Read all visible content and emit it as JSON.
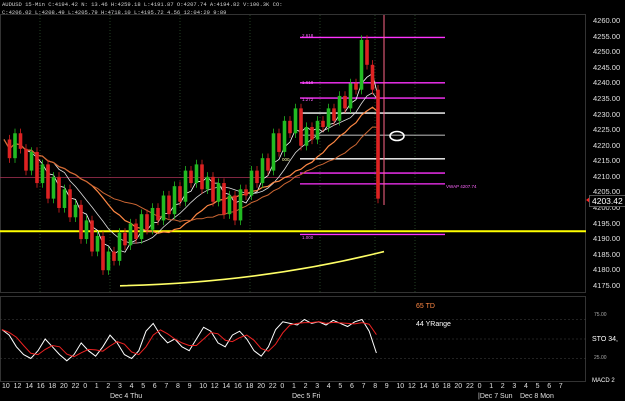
{
  "header": {
    "line1": "AUDUSD 15-Min  C:4194.42  N: 13.46  H:4259.18  L:4191.87  O:4207.74  A:4194.82  V:100.3K  CO:",
    "line2": "C:4206.02  L:4208.49  L:4205.79  H:4718.10  L:4195.72  4.56  12:04:29  9:89"
  },
  "price_axis": {
    "ticks": [
      "4260.00",
      "4255.00",
      "4250.00",
      "4245.00",
      "4240.00",
      "4235.00",
      "4230.00",
      "4225.00",
      "4220.00",
      "4215.00",
      "4210.00",
      "4205.00",
      "4200.00",
      "4195.00",
      "4190.00",
      "4185.00",
      "4180.00",
      "4175.00"
    ],
    "current_price": "4203.42"
  },
  "fib_labels": {
    "f2618": "2.618",
    "f1618": "1.618",
    "f1272": "1.272",
    "f0": "000",
    "vwap": "VWAP 4207.74",
    "f_1": "1.000"
  },
  "indicator": {
    "label_td": "65 TD",
    "label_range": "44 YRange",
    "label_sto": "STO 34,",
    "label_macd": "MACD 2",
    "tick75": "75.00",
    "tick50": "50.00",
    "tick25": "25.00"
  },
  "time_axis": {
    "ticks": [
      "10",
      "12",
      "14",
      "16",
      "18",
      "20",
      "22",
      "0",
      "1",
      "2",
      "3",
      "4",
      "5",
      "6",
      "7",
      "8",
      "9",
      "10",
      "12",
      "14",
      "16",
      "18",
      "20",
      "22",
      "0",
      "1",
      "2",
      "3",
      "4",
      "5",
      "6",
      "7",
      "8",
      "9",
      "10",
      "12",
      "14",
      "16",
      "18",
      "20",
      "22",
      "0",
      "1",
      "2",
      "3",
      "4",
      "5",
      "6",
      "7"
    ],
    "days": [
      "Dec 4 Thu",
      "Dec 5 Fri",
      "|Dec 7 Sun",
      "Dec 8 Mon"
    ]
  },
  "colors": {
    "background": "#000000",
    "up_candle": "#22bb22",
    "down_candle": "#dd2222",
    "fib_lines": "#ff33ff",
    "support_line": "#ffff00",
    "white_lines": "#ffffff",
    "ma_orange": "#ff8844"
  },
  "chart_data": {
    "type": "candlestick",
    "title": "AUDUSD 15-Min",
    "ylim": [
      4173,
      4262
    ],
    "x": [
      "Dec 4 Thu",
      "Dec 5 Fri",
      "Dec 7 Sun",
      "Dec 8 Mon"
    ],
    "levels": {
      "fib_2618": 4254.8,
      "fib_1618": 4240.2,
      "fib_1272": 4235.3,
      "white_1": 4230.5,
      "white_2": 4223.4,
      "white_3": 4215.8,
      "fib_0": 4211.2,
      "vwap": 4207.74,
      "fib_neg": 4191.5,
      "support_yellow": 4192.5
    },
    "price_series": [
      4222,
      4216,
      4224,
      4219,
      4212,
      4218,
      4208,
      4214,
      4203,
      4210,
      4200,
      4206,
      4197,
      4201,
      4190,
      4196,
      4186,
      4191,
      4180,
      4186,
      4183,
      4192,
      4188,
      4195,
      4190,
      4198,
      4193,
      4200,
      4196,
      4204,
      4198,
      4207,
      4202,
      4212,
      4208,
      4214,
      4206,
      4210,
      4202,
      4208,
      4198,
      4204,
      4196,
      4206,
      4204,
      4212,
      4208,
      4216,
      4212,
      4224,
      4218,
      4228,
      4224,
      4232,
      4220,
      4226,
      4222,
      4228,
      4226,
      4232,
      4228,
      4236,
      4232,
      4240,
      4238,
      4254,
      4246,
      4238,
      4203
    ],
    "stochastic": [
      62,
      55,
      40,
      30,
      25,
      35,
      50,
      40,
      30,
      22,
      30,
      45,
      35,
      28,
      40,
      55,
      45,
      30,
      25,
      35,
      60,
      70,
      55,
      45,
      50,
      40,
      35,
      50,
      65,
      60,
      45,
      40,
      55,
      60,
      50,
      35,
      28,
      40,
      62,
      72,
      70,
      68,
      75,
      70,
      72,
      68,
      74,
      70,
      66,
      72,
      75,
      60,
      32
    ]
  }
}
